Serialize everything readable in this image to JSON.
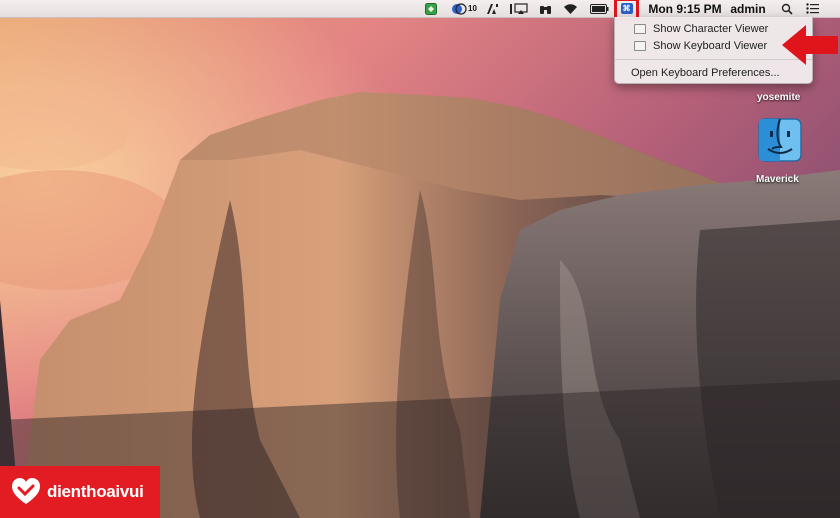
{
  "menubar": {
    "badge_count": "10",
    "clock": "Mon 9:15 PM",
    "user": "admin",
    "input_source_icon": "input-source-icon"
  },
  "dropdown": {
    "items": [
      {
        "label": "Show Character Viewer",
        "icon": "character-viewer-icon"
      },
      {
        "label": "Show Keyboard Viewer",
        "icon": "keyboard-viewer-icon"
      },
      {
        "label": "Open Keyboard Preferences..."
      }
    ]
  },
  "desktop": {
    "icons": [
      {
        "label": "yosemite"
      },
      {
        "label": "Maverick",
        "icon": "finder-icon"
      }
    ]
  },
  "brand": {
    "text": "dienthoaivui"
  },
  "colors": {
    "highlight": "#e0151c",
    "brand": "#e31b23",
    "menubar": "#efe9ea"
  }
}
